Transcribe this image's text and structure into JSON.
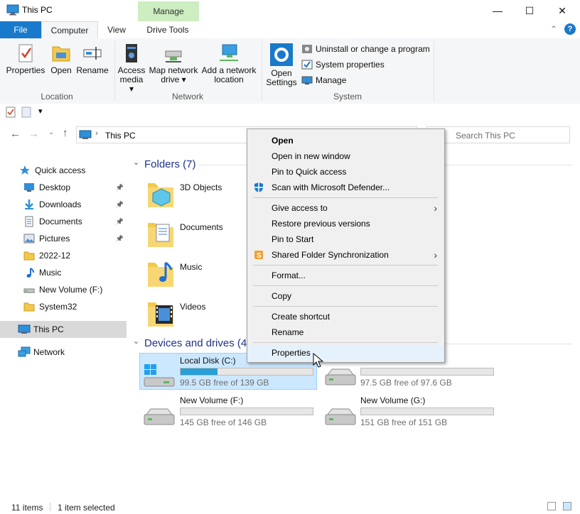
{
  "window": {
    "title": "This PC",
    "minimize": "—",
    "maximize": "☐",
    "close": "✕"
  },
  "ribbon_tabs": {
    "file": "File",
    "computer": "Computer",
    "view": "View",
    "manage_context": "Manage",
    "drive_tools": "Drive Tools"
  },
  "ribbon": {
    "location": {
      "label": "Location",
      "properties": "Properties",
      "open": "Open",
      "rename": "Rename"
    },
    "network": {
      "label": "Network",
      "access_media": "Access media",
      "map_network_drive": "Map network drive",
      "add_network_location": "Add a network location"
    },
    "system": {
      "label": "System",
      "open_settings": "Open Settings",
      "uninstall": "Uninstall or change a program",
      "system_properties": "System properties",
      "manage": "Manage"
    }
  },
  "address": {
    "path": "This PC",
    "search_placeholder": "Search This PC"
  },
  "nav": {
    "quick_access": "Quick access",
    "items": [
      {
        "label": "Desktop",
        "pinned": true
      },
      {
        "label": "Downloads",
        "pinned": true
      },
      {
        "label": "Documents",
        "pinned": true
      },
      {
        "label": "Pictures",
        "pinned": true
      },
      {
        "label": "2022-12",
        "pinned": false
      },
      {
        "label": "Music",
        "pinned": false
      },
      {
        "label": "New Volume (F:)",
        "pinned": false
      },
      {
        "label": "System32",
        "pinned": false
      }
    ],
    "this_pc": "This PC",
    "network": "Network"
  },
  "folders": {
    "title": "Folders (7)",
    "items": [
      "3D Objects",
      "Documents",
      "Music",
      "Videos"
    ]
  },
  "drives": {
    "title": "Devices and drives (4)",
    "items": [
      {
        "name": "Local Disk (C:)",
        "free": "99.5 GB free of 139 GB",
        "used_fraction": 0.28
      },
      {
        "name": "",
        "free": "97.5 GB free of 97.6 GB",
        "used_fraction": 0.0
      },
      {
        "name": "New Volume (F:)",
        "free": "145 GB free of 146 GB",
        "used_fraction": 0.0
      },
      {
        "name": "New Volume (G:)",
        "free": "151 GB free of 151 GB",
        "used_fraction": 0.0
      }
    ]
  },
  "status": {
    "count": "11 items",
    "selected": "1 item selected"
  },
  "context_menu": {
    "open": "Open",
    "open_new_window": "Open in new window",
    "pin_quick_access": "Pin to Quick access",
    "scan_defender": "Scan with Microsoft Defender...",
    "give_access": "Give access to",
    "restore_versions": "Restore previous versions",
    "pin_start": "Pin to Start",
    "shared_sync": "Shared Folder Synchronization",
    "format": "Format...",
    "copy": "Copy",
    "create_shortcut": "Create shortcut",
    "rename": "Rename",
    "properties": "Properties"
  },
  "colors": {
    "accent": "#1979ca",
    "selection": "#cce8ff",
    "section_title": "#1e3287",
    "manage_tab": "#cdeec0",
    "drive_bar": "#26a0da"
  }
}
